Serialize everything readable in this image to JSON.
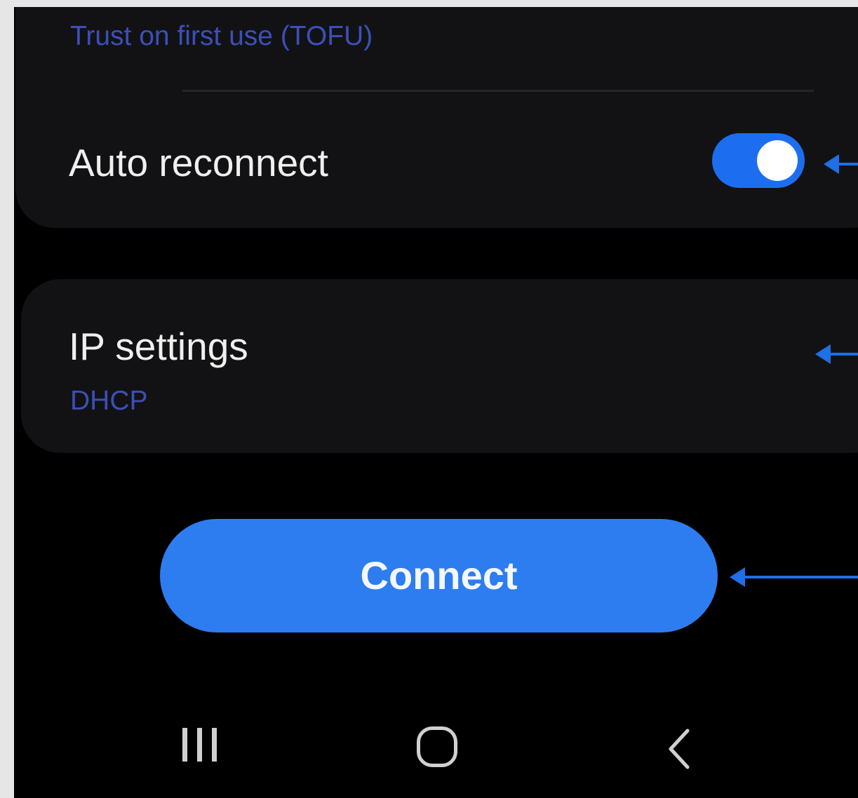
{
  "eap": {
    "ca_certificate_value": "Trust on first use (TOFU)"
  },
  "auto_reconnect": {
    "label": "Auto reconnect",
    "enabled": true
  },
  "ip_settings": {
    "label": "IP settings",
    "value": "DHCP"
  },
  "connect_button": {
    "label": "Connect"
  },
  "nav_bar": {
    "recents_icon": "recents-icon",
    "home_icon": "home-icon",
    "back_icon": "back-icon"
  },
  "colors": {
    "accent": "#2d7df0",
    "subtitle": "#3c4fb8",
    "annotation_arrow": "#1f6fe6"
  }
}
